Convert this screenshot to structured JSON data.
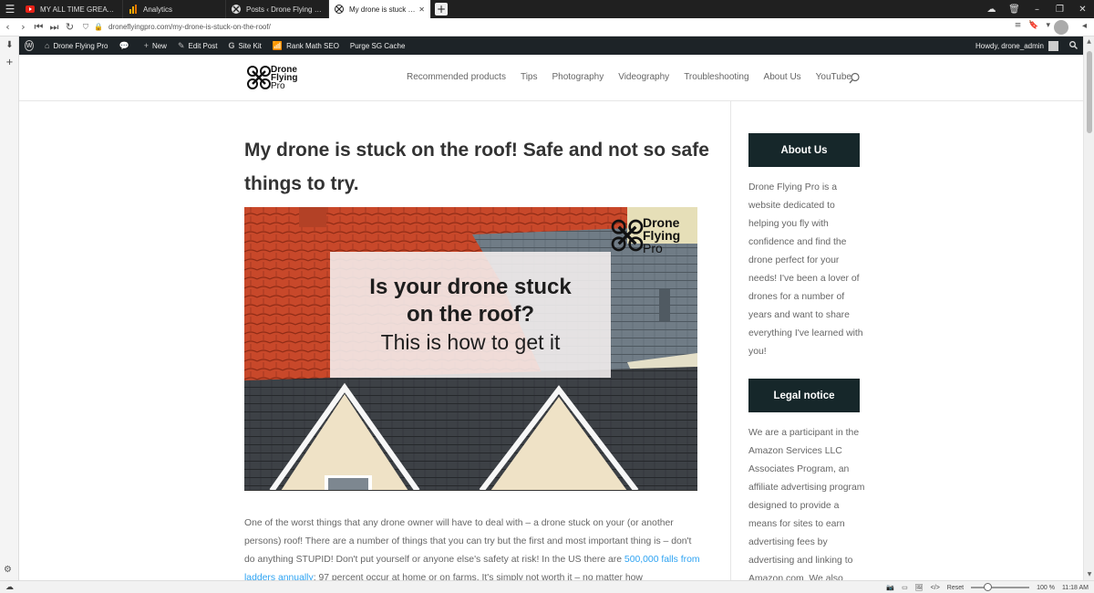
{
  "browser": {
    "tabs": [
      {
        "label": "MY ALL TIME GREATEST!!!!",
        "icon": "youtube-icon",
        "active": false
      },
      {
        "label": "Analytics",
        "icon": "analytics-icon",
        "active": false
      },
      {
        "label": "Posts ‹ Drone Flying Pro —",
        "icon": "drone-logo-icon",
        "active": false
      },
      {
        "label": "My drone is stuck on the ro",
        "icon": "drone-logo-icon",
        "active": true
      }
    ],
    "url": "droneflyingpro.com/my-drone-is-stuck-on-the-roof/"
  },
  "adminbar": {
    "site_name": "Drone Flying Pro",
    "new_label": "New",
    "edit_post": "Edit Post",
    "site_kit": "Site Kit",
    "rank_math": "Rank Math SEO",
    "purge_cache": "Purge SG Cache",
    "howdy": "Howdy, drone_admin"
  },
  "site": {
    "logo_line1": "Drone",
    "logo_line2": "Flying",
    "logo_line3": "Pro",
    "nav": [
      "Recommended products",
      "Tips",
      "Photography",
      "Videography",
      "Troubleshooting",
      "About Us",
      "YouTube"
    ]
  },
  "post": {
    "title": "My drone is stuck on the roof! Safe and not so safe things to try.",
    "hero": {
      "line1": "Is your drone stuck",
      "line2": "on the roof?",
      "line3": "This is how to get it",
      "logo_drone": "Drone",
      "logo_flying": "Flying",
      "logo_pro": "Pro"
    },
    "body_before_link": "One of the worst things that any drone owner will have to deal with – a drone stuck on your (or another persons) roof! There are a number of things that you can try but the first and most important thing is – don't do anything STUPID! Don't put yourself or anyone else's safety at risk! In the US there are ",
    "body_link": "500,000 falls from ladders annually",
    "body_after_link": ": 97 percent occur at home or on farms. It's simply not worth it – no matter how"
  },
  "sidebar": {
    "about_title": "About Us",
    "about_text": "Drone Flying Pro is a website dedicated to helping you fly with confidence and find the drone perfect for your needs! I've been a lover of drones for a number of years and want to share everything I've learned with you!",
    "legal_title": "Legal notice",
    "legal_text": "We are a participant in the Amazon Services LLC Associates Program, an affiliate advertising program designed to provide a means for sites to earn advertising fees by advertising and linking to Amazon.com. We also"
  },
  "statusbar": {
    "reset": "Reset",
    "zoom": "100 %",
    "time": "11:18 AM",
    "zoom_percent": 100
  },
  "colors": {
    "admin_bar": "#1d2327",
    "widget_title_bg": "#16272a",
    "link": "#2ea3f2"
  }
}
